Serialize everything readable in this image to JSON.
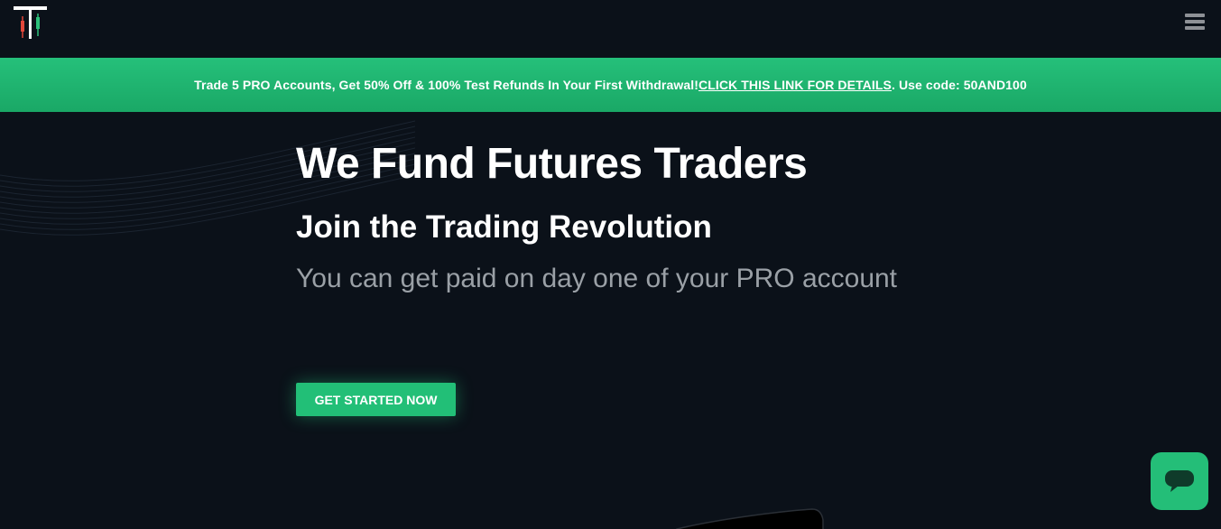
{
  "header": {
    "logo_icon": "candlestick-logo-icon",
    "menu_icon": "hamburger-menu-icon"
  },
  "promo": {
    "text_before": "Trade 5 PRO Accounts, Get 50% Off & 100% Test Refunds In Your First Withdrawal! ",
    "link_label": "CLICK THIS LINK FOR DETAILS",
    "text_after": ". Use code: 50AND100"
  },
  "hero": {
    "title": "We Fund Futures Traders",
    "subtitle": "Join the Trading Revolution",
    "tagline": "You can get paid on day one of your PRO account",
    "cta_label": "GET STARTED NOW"
  },
  "chat": {
    "icon": "chat-bubble-icon"
  },
  "colors": {
    "background": "#0b1119",
    "accent_green": "#22bf77",
    "logo_red": "#e2473b",
    "logo_green": "#2cc07a",
    "muted_text": "#9aa0a6",
    "menu_gray": "#8e9196"
  }
}
